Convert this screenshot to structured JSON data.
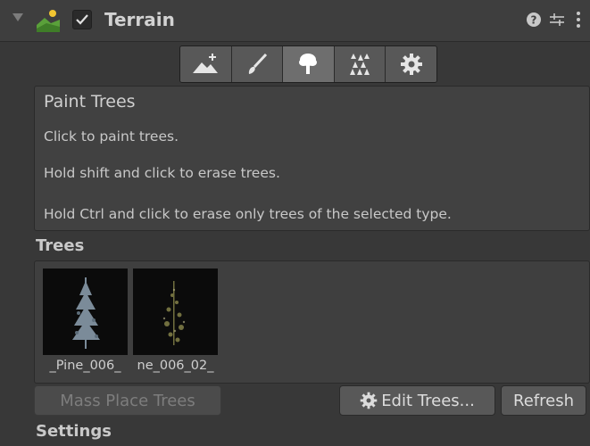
{
  "header": {
    "title": "Terrain",
    "enabled": true,
    "icons": {
      "foldout": "foldout-arrow-icon",
      "component": "terrain-icon",
      "help": "help-icon",
      "presets": "presets-icon",
      "menu": "kebab-menu-icon"
    }
  },
  "toolbar": {
    "tools": [
      {
        "name": "raise-lower-terrain-icon"
      },
      {
        "name": "paint-brush-icon"
      },
      {
        "name": "paint-trees-icon",
        "active": true
      },
      {
        "name": "paint-details-icon"
      },
      {
        "name": "terrain-settings-icon"
      }
    ]
  },
  "help": {
    "title": "Paint Trees",
    "lines": [
      "Click to paint trees.",
      "Hold shift and click to erase trees.",
      "Hold Ctrl and click to erase only trees of the selected type."
    ]
  },
  "trees": {
    "label": "Trees",
    "items": [
      {
        "caption": "_Pine_006_"
      },
      {
        "caption": "ne_006_02_"
      }
    ]
  },
  "buttons": {
    "mass_place": "Mass Place Trees",
    "edit_trees": "Edit Trees...",
    "refresh": "Refresh"
  },
  "settings": {
    "label": "Settings"
  },
  "colors": {
    "panel": "#383838",
    "header": "#3e3e3e",
    "button": "#585858",
    "active_button": "#6e6e6e",
    "text": "#c4c4c4"
  }
}
